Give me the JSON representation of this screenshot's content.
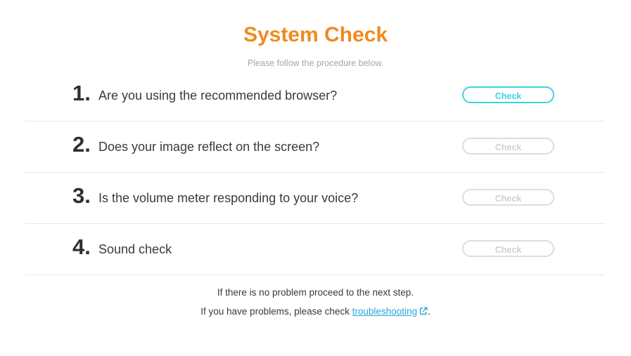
{
  "header": {
    "title": "System Check",
    "subtitle": "Please follow the procedure below."
  },
  "steps": [
    {
      "number": "1.",
      "text": "Are you using the recommended browser?",
      "button_label": "Check",
      "active": true
    },
    {
      "number": "2.",
      "text": "Does your image reflect on the screen?",
      "button_label": "Check",
      "active": false
    },
    {
      "number": "3.",
      "text": "Is the volume meter responding to your voice?",
      "button_label": "Check",
      "active": false
    },
    {
      "number": "4.",
      "text": "Sound check",
      "button_label": "Check",
      "active": false
    }
  ],
  "footer": {
    "line1": "If there is no problem proceed to the next step.",
    "line2_prefix": "If you have problems, please check ",
    "link_text": "troubleshooting",
    "line2_suffix": ".",
    "link_icon": "external-link-icon"
  },
  "colors": {
    "title": "#ef8b1f",
    "active_button": "#3ed3df",
    "inactive_button_border": "#e0ddd6",
    "link": "#2aa3d8"
  }
}
